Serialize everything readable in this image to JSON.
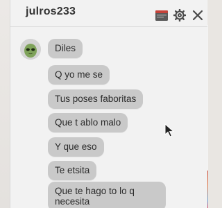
{
  "chat": {
    "username": "julros233",
    "accent_color": "#c9c9c9",
    "icons": {
      "inventory": "inventory-icon",
      "settings": "gear-icon",
      "close": "close-icon"
    },
    "messages": [
      "Diles",
      "Q yo me se",
      "Tus poses faboritas",
      "Que t ablo malo",
      "Y que eso",
      "Te etsita",
      "Que te hago to lo q necesita"
    ]
  }
}
